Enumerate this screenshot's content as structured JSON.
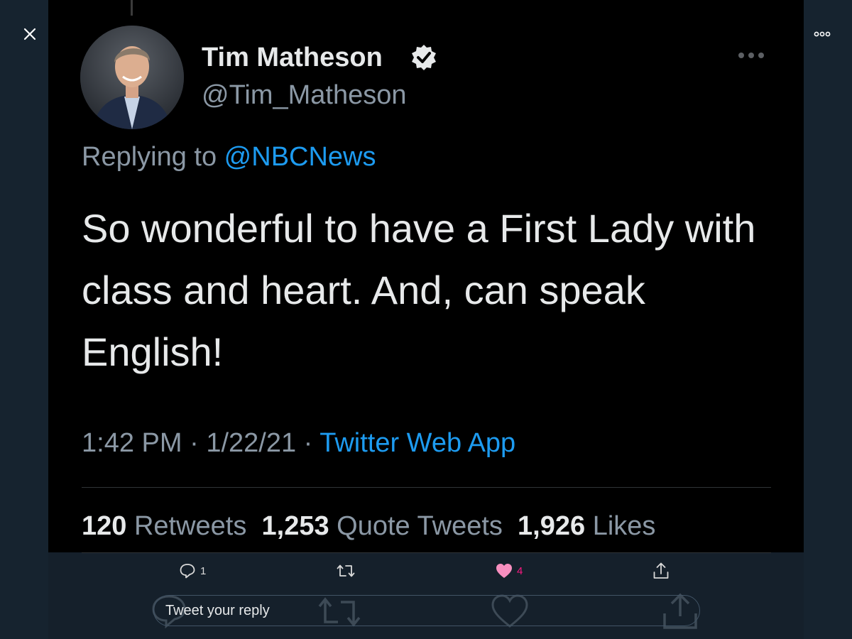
{
  "tweet": {
    "display_name": "Tim Matheson",
    "handle": "@Tim_Matheson",
    "replying_prefix": "Replying to ",
    "replying_to": "@NBCNews",
    "text": "So wonderful to have a First Lady with class and heart.  And, can speak English!",
    "time": "1:42 PM",
    "date": "1/22/21",
    "separator": " · ",
    "source": "Twitter Web App",
    "stats": {
      "retweets": "120",
      "retweets_label": " Retweets",
      "quotes": "1,253",
      "quotes_label": " Quote Tweets",
      "likes": "1,926",
      "likes_label": " Likes"
    }
  },
  "actions": {
    "reply_count": "1",
    "like_count": "4"
  },
  "reply_box": {
    "placeholder": "Tweet your reply"
  },
  "colors": {
    "background": "#15202b",
    "accent": "#1d9bf0",
    "like": "#f91880",
    "tweet_bg": "#000000"
  },
  "icons": {
    "close": "close-icon",
    "more": "more-icon",
    "verified": "verified-badge-icon",
    "reply": "reply-icon",
    "retweet": "retweet-icon",
    "like": "heart-icon",
    "share": "share-icon"
  }
}
